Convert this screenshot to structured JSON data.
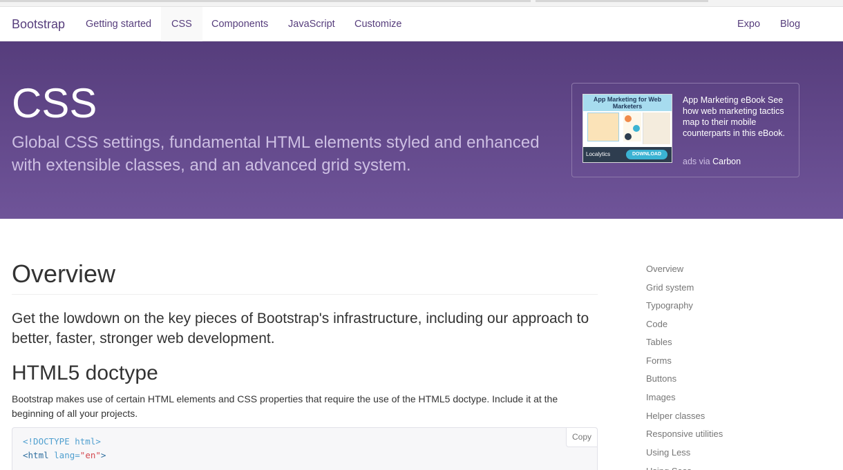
{
  "navbar": {
    "brand": "Bootstrap",
    "items": [
      "Getting started",
      "CSS",
      "Components",
      "JavaScript",
      "Customize"
    ],
    "right_items": [
      "Expo",
      "Blog"
    ],
    "active": "CSS"
  },
  "hero": {
    "title": "CSS",
    "subtitle": "Global CSS settings, fundamental HTML elements styled and enhanced with extensible classes, and an advanced grid system."
  },
  "ad": {
    "image_title": "App Marketing for Web Marketers",
    "image_brand": "Localytics",
    "image_button": "DOWNLOAD",
    "text": "App Marketing eBook See how web marketing tactics map to their mobile counterparts in this eBook.",
    "via_prefix": "ads via ",
    "via_link": "Carbon"
  },
  "main": {
    "heading": "Overview",
    "lead": "Get the lowdown on the key pieces of Bootstrap's infrastructure, including our approach to better, faster, stronger web development.",
    "section_heading": "HTML5 doctype",
    "section_text": "Bootstrap makes use of certain HTML elements and CSS properties that require the use of the HTML5 doctype. Include it at the beginning of all your projects.",
    "copy_label": "Copy",
    "code_line1": "<!DOCTYPE html>",
    "code_line2_tag_open": "<html ",
    "code_line2_attr": "lang=",
    "code_line2_val": "\"en\"",
    "code_line2_close": ">",
    "code_line3": "  ..."
  },
  "sidenav": {
    "items": [
      "Overview",
      "Grid system",
      "Typography",
      "Code",
      "Tables",
      "Forms",
      "Buttons",
      "Images",
      "Helper classes",
      "Responsive utilities",
      "Using Less",
      "Using Sass"
    ]
  },
  "colors": {
    "brand_purple": "#563d7c",
    "hero_bottom": "#6f5499",
    "link_gray": "#767676"
  }
}
